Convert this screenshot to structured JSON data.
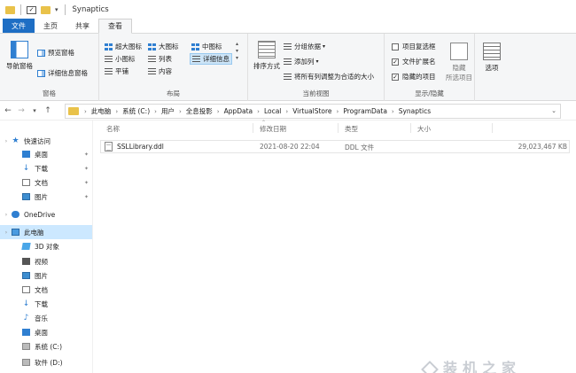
{
  "window": {
    "title": "Synaptics"
  },
  "ribbon_tabs": [
    "文件",
    "主页",
    "共享",
    "查看"
  ],
  "ribbon": {
    "panes": {
      "label": "窗格",
      "nav_pane": "导航窗格",
      "preview_pane": "预览窗格",
      "details_pane": "详细信息窗格"
    },
    "layout": {
      "label": "布局",
      "extra_large": "超大图标",
      "large": "大图标",
      "medium": "中图标",
      "small": "小图标",
      "list": "列表",
      "details": "详细信息",
      "tiles": "平铺",
      "content": "内容",
      "selected": "详细信息"
    },
    "current_view": {
      "label": "当前视图",
      "sort_by": "排序方式",
      "group_by": "分组依据",
      "add_columns": "添加列",
      "fit_columns": "将所有列调整为合适的大小"
    },
    "show_hide": {
      "label": "显示/隐藏",
      "item_checkboxes": "项目复选框",
      "item_checkboxes_checked": false,
      "file_extensions": "文件扩展名",
      "file_extensions_checked": true,
      "hidden_items": "隐藏的项目",
      "hidden_items_checked": true,
      "hide_selected_line1": "隐藏",
      "hide_selected_line2": "所选项目"
    },
    "options": "选项"
  },
  "address": {
    "crumbs": [
      "此电脑",
      "系统 (C:)",
      "用户",
      "全息投影",
      "AppData",
      "Local",
      "VirtualStore",
      "ProgramData",
      "Synaptics"
    ]
  },
  "nav_pane": {
    "items": [
      {
        "label": "快速访问",
        "icon": "star-icon"
      },
      {
        "label": "桌面",
        "icon": "desktop-icon",
        "pinned": true
      },
      {
        "label": "下载",
        "icon": "download-icon",
        "pinned": true
      },
      {
        "label": "文档",
        "icon": "document-icon",
        "pinned": true
      },
      {
        "label": "图片",
        "icon": "picture-icon",
        "pinned": true
      },
      {
        "label": "OneDrive",
        "icon": "cloud-icon"
      },
      {
        "label": "此电脑",
        "icon": "computer-icon",
        "selected": true
      },
      {
        "label": "3D 对象",
        "icon": "cube-icon"
      },
      {
        "label": "视频",
        "icon": "video-icon"
      },
      {
        "label": "图片",
        "icon": "picture-icon"
      },
      {
        "label": "文档",
        "icon": "document-icon"
      },
      {
        "label": "下载",
        "icon": "download-icon"
      },
      {
        "label": "音乐",
        "icon": "music-icon"
      },
      {
        "label": "桌面",
        "icon": "desktop-icon"
      },
      {
        "label": "系统 (C:)",
        "icon": "drive-icon"
      },
      {
        "label": "软件 (D:)",
        "icon": "drive-icon"
      }
    ]
  },
  "file_list": {
    "columns": [
      "名称",
      "修改日期",
      "类型",
      "大小"
    ],
    "rows": [
      {
        "name": "SSLLibrary.ddl",
        "modified": "2021-08-20 22:04",
        "type": "DDL 文件",
        "size": "29,023,467 KB"
      }
    ]
  },
  "colors": {
    "accent": "#1e6ec4",
    "selection": "#cce8ff",
    "folder": "#e9c24a"
  }
}
